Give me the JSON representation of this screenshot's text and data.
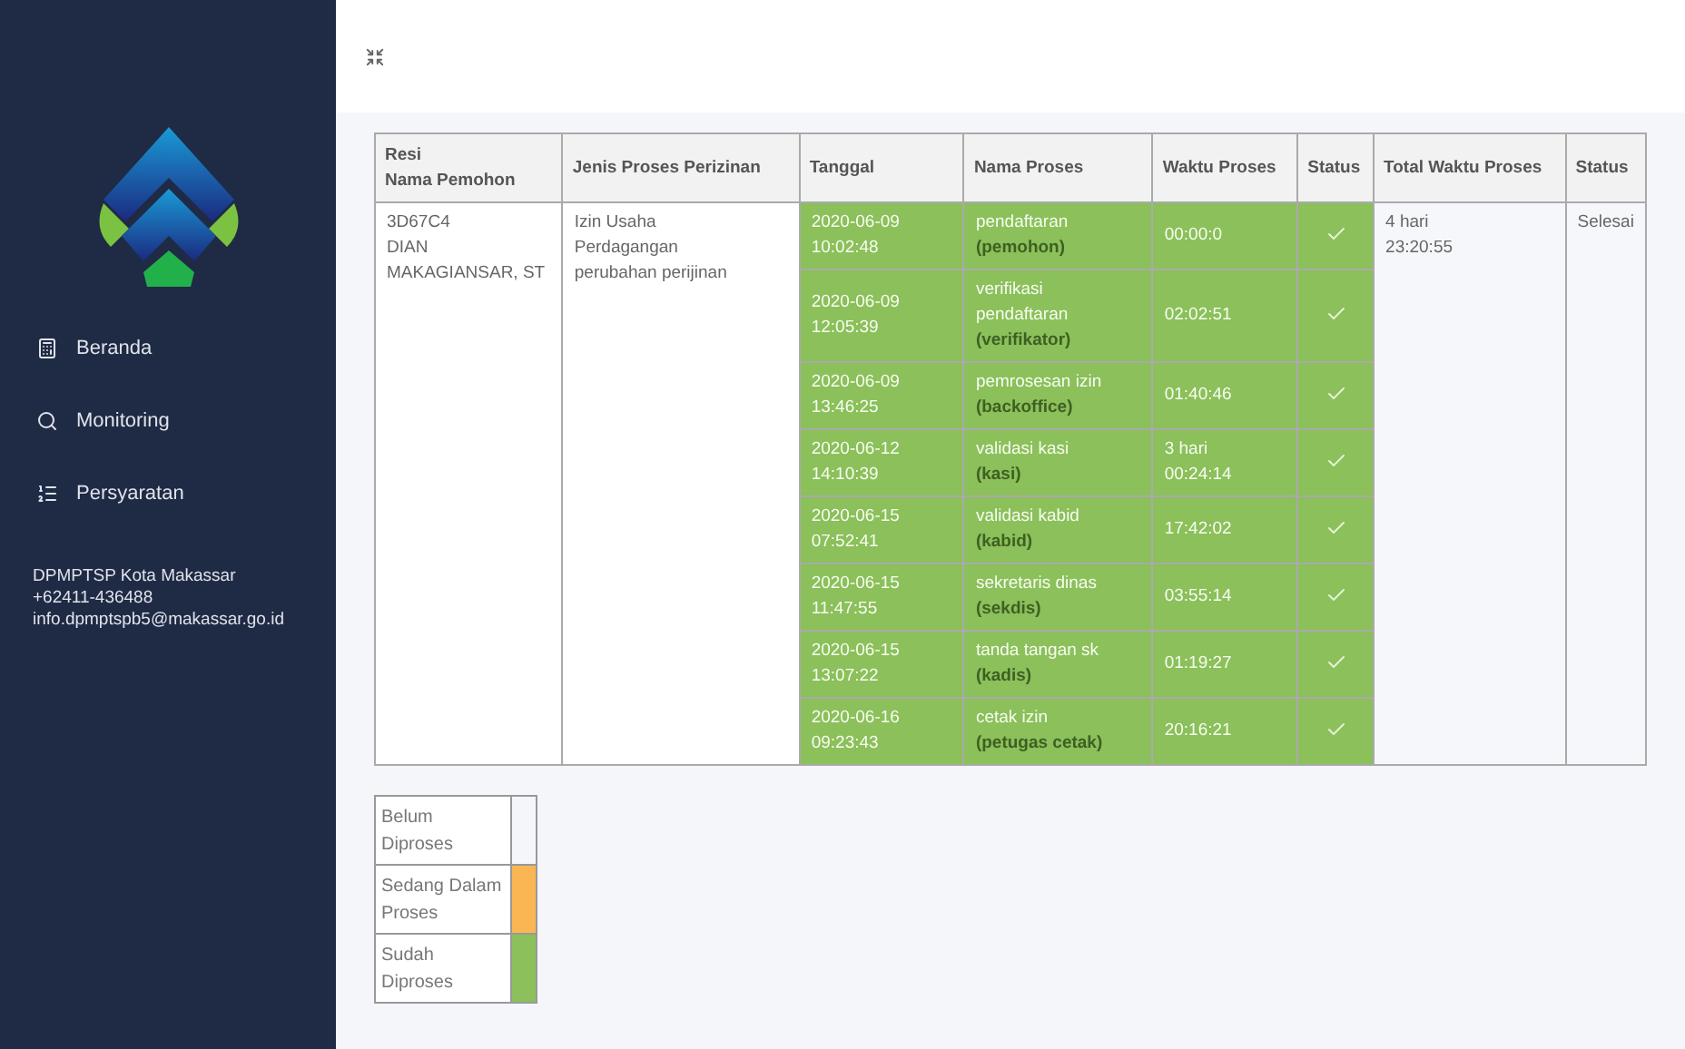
{
  "sidebar": {
    "items": [
      {
        "label": "Beranda",
        "selected": false
      },
      {
        "label": "Monitoring",
        "selected": false
      },
      {
        "label": "Persyaratan",
        "selected": false
      }
    ],
    "contact": [
      "DPMPTSP Kota Makassar",
      "+62411-436488",
      "info.dpmptspb5@makassar.go.id"
    ]
  },
  "table": {
    "columns": [
      "Resi\nNama Pemohon",
      "Jenis Proses Perizinan",
      "Tanggal",
      "Nama Proses",
      "Waktu Proses",
      "Status",
      "Total Waktu Proses",
      "Status"
    ],
    "record": {
      "resi": "3D67C4\nDIAN MAKAGIANSAR, ST",
      "jenis": "Izin Usaha\nPerdagangan\nperubahan perijinan",
      "total": "4 hari\n23:20:55",
      "status": "Selesai",
      "steps": [
        {
          "date": "2020-06-09\n10:02:48",
          "name": "pendaftaran",
          "role": "(pemohon)",
          "duration": "00:00:0",
          "checked": true
        },
        {
          "date": "2020-06-09\n12:05:39",
          "name": "verifikasi\npendaftaran",
          "role": "(verifikator)",
          "duration": "02:02:51",
          "checked": true
        },
        {
          "date": "2020-06-09\n13:46:25",
          "name": "pemrosesan izin",
          "role": "(backoffice)",
          "duration": "01:40:46",
          "checked": true
        },
        {
          "date": "2020-06-12\n14:10:39",
          "name": "validasi kasi",
          "role": "(kasi)",
          "duration": "3 hari\n00:24:14",
          "checked": true
        },
        {
          "date": "2020-06-15\n07:52:41",
          "name": "validasi kabid",
          "role": "(kabid)",
          "duration": "17:42:02",
          "checked": true
        },
        {
          "date": "2020-06-15\n11:47:55",
          "name": "sekretaris dinas",
          "role": "(sekdis)",
          "duration": "03:55:14",
          "checked": true
        },
        {
          "date": "2020-06-15\n13:07:22",
          "name": "tanda tangan sk",
          "role": "(kadis)",
          "duration": "01:19:27",
          "checked": true
        },
        {
          "date": "2020-06-16\n09:23:43",
          "name": "cetak izin",
          "role": "(petugas cetak)",
          "duration": "20:16:21",
          "checked": true
        }
      ]
    }
  },
  "legend": [
    {
      "label": "Belum\nDiproses",
      "color": "#f5f6fa"
    },
    {
      "label": "Sedang Dalam\nProses",
      "color": "#fbb654"
    },
    {
      "label": "Sudah\nDiproses",
      "color": "#8bc05a"
    }
  ]
}
